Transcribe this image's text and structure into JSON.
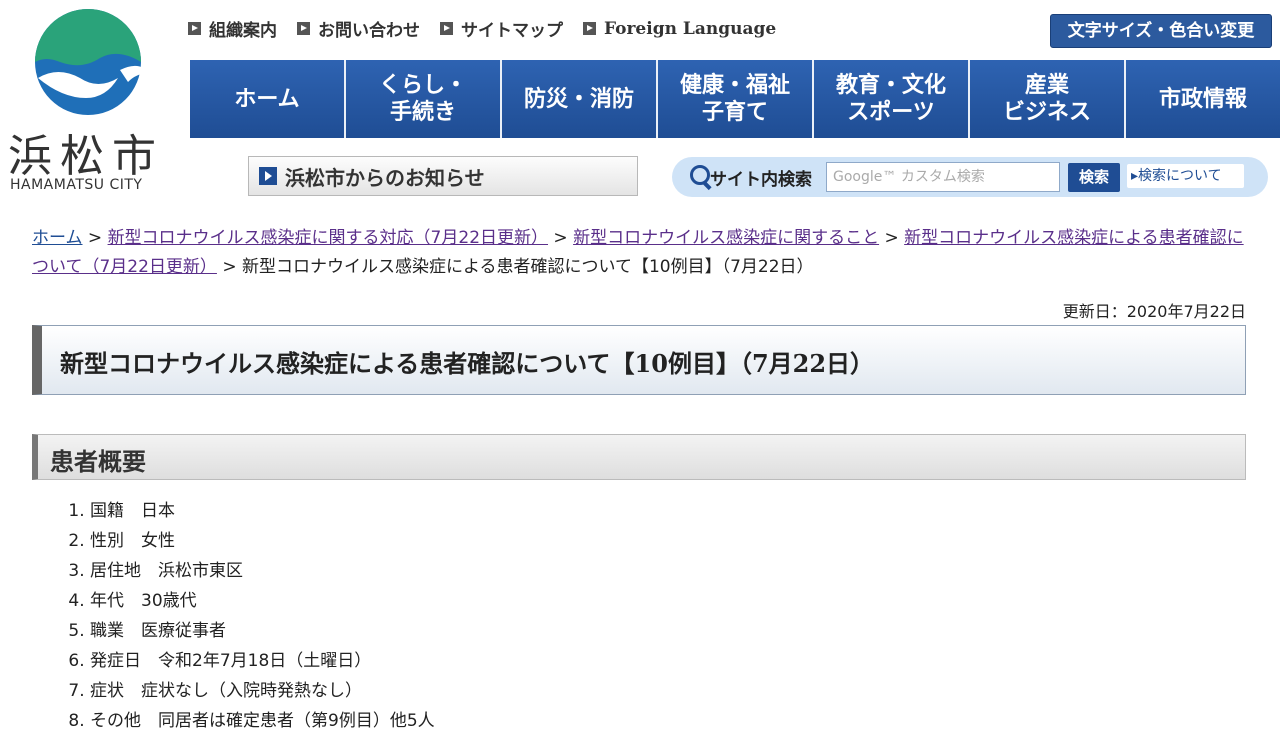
{
  "logo": {
    "name": "浜松市",
    "english": "HAMAMATSU CITY"
  },
  "util_nav": [
    "組織案内",
    "お問い合わせ",
    "サイトマップ",
    "Foreign Language"
  ],
  "font_color_button": "文字サイズ・色合い変更",
  "global_nav": [
    "ホーム",
    "くらし・\n手続き",
    "防災・消防",
    "健康・福祉\n子育て",
    "教育・文化\nスポーツ",
    "産業\nビジネス",
    "市政情報"
  ],
  "notice": "浜松市からのお知らせ",
  "search": {
    "label": "サイト内検索",
    "placeholder": "Google™ カスタム検索",
    "button": "検索",
    "about": "検索について"
  },
  "breadcrumb": {
    "home": "ホーム",
    "link1": "新型コロナウイルス感染症に関する対応（7月22日更新）",
    "link2": "新型コロナウイルス感染症に関すること",
    "link3": "新型コロナウイルス感染症による患者確認について（7月22日更新）",
    "current": "新型コロナウイルス感染症による患者確認について【10例目】（7月22日）",
    "sep": " > "
  },
  "updated": "更新日：2020年7月22日",
  "page_title": "新型コロナウイルス感染症による患者確認について【10例目】（7月22日）",
  "section_heading": "患者概要",
  "patient_info": [
    "国籍　日本",
    "性別　女性",
    "居住地　浜松市東区",
    "年代　30歳代",
    "職業　医療従事者",
    "発症日　令和2年7月18日（土曜日）",
    "症状　症状なし（入院時発熱なし）",
    "その他　同居者は確定患者（第9例目）他5人"
  ],
  "colors": {
    "nav_blue": "#1f4d94",
    "visited_link": "#5a2f8a",
    "logo_green": "#2aa37a",
    "logo_blue": "#1f6fb8"
  }
}
